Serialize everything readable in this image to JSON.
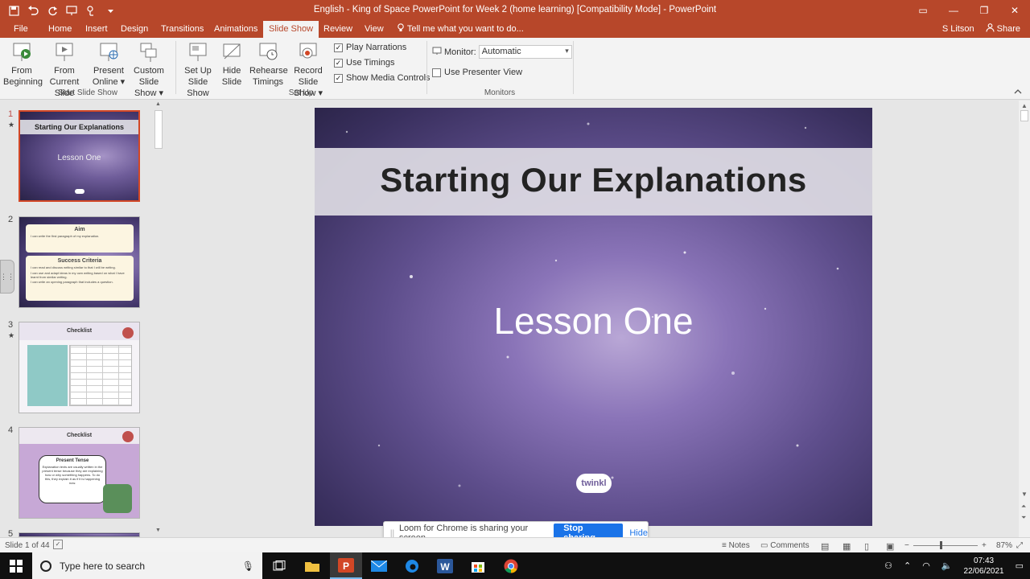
{
  "window": {
    "title": "English - King of Space PowerPoint for Week 2 (home learning) [Compatibility Mode] - PowerPoint",
    "controls": {
      "ribbon_display": "▭",
      "minimize": "—",
      "restore": "❐",
      "close": "✕"
    }
  },
  "qat": [
    "save-icon",
    "undo-icon",
    "redo-icon",
    "present-icon",
    "touch-mode-icon",
    "customize-icon"
  ],
  "tabs": [
    {
      "id": "file",
      "label": "File"
    },
    {
      "id": "home",
      "label": "Home"
    },
    {
      "id": "insert",
      "label": "Insert"
    },
    {
      "id": "design",
      "label": "Design"
    },
    {
      "id": "transitions",
      "label": "Transitions"
    },
    {
      "id": "animations",
      "label": "Animations"
    },
    {
      "id": "slideshow",
      "label": "Slide Show"
    },
    {
      "id": "review",
      "label": "Review"
    },
    {
      "id": "view",
      "label": "View"
    }
  ],
  "tellme": "Tell me what you want to do...",
  "user": {
    "name": "S Litson",
    "share": "Share"
  },
  "ribbon": {
    "start_group": {
      "label": "Start Slide Show",
      "buttons": [
        {
          "line1": "From",
          "line2": "Beginning"
        },
        {
          "line1": "From",
          "line2": "Current Slide"
        },
        {
          "line1": "Present",
          "line2": "Online ▾"
        },
        {
          "line1": "Custom Slide",
          "line2": "Show ▾"
        }
      ]
    },
    "setup_group": {
      "label": "Set Up",
      "buttons": [
        {
          "line1": "Set Up",
          "line2": "Slide Show"
        },
        {
          "line1": "Hide",
          "line2": "Slide"
        },
        {
          "line1": "Rehearse",
          "line2": "Timings"
        },
        {
          "line1": "Record Slide",
          "line2": "Show ▾"
        }
      ],
      "checks": [
        {
          "label": "Play Narrations",
          "checked": true
        },
        {
          "label": "Use Timings",
          "checked": true
        },
        {
          "label": "Show Media Controls",
          "checked": true
        }
      ]
    },
    "monitors_group": {
      "label": "Monitors",
      "monitor_label": "Monitor:",
      "monitor_value": "Automatic",
      "presenter_view": {
        "label": "Use Presenter View",
        "checked": false
      }
    }
  },
  "thumbnails": [
    {
      "num": "1",
      "title": "Starting Our Explanations",
      "subtitle": "Lesson One"
    },
    {
      "num": "2",
      "title": "Aim",
      "aim_text": "I can write the first paragraph of my explanation.",
      "title2": "Success Criteria",
      "bullets": [
        "I can read and discuss writing similar to that I will be writing.",
        "I can use and adapt ideas in my own writing based on what I have learnt from similar writing.",
        "I can write an opening paragraph that includes a question."
      ]
    },
    {
      "num": "3",
      "title": "Checklist"
    },
    {
      "num": "4",
      "title": "Checklist",
      "subtitle": "Present Tense",
      "body": "Explanation texts are usually written in the present tense because they are explaining how or why something happens. To do this, they explain it as if it is happening now."
    },
    {
      "num": "5"
    }
  ],
  "slide": {
    "title": "Starting Our Explanations",
    "subtitle": "Lesson One",
    "logo": "twinkl"
  },
  "loom": {
    "message": "Loom for Chrome is sharing your screen.",
    "stop": "Stop sharing",
    "hide": "Hide"
  },
  "status": {
    "slide_info": "Slide 1 of 44",
    "notes": "Notes",
    "comments": "Comments",
    "zoom": "87%",
    "zoom_percent": 87
  },
  "taskbar": {
    "search_placeholder": "Type here to search",
    "time": "07:43",
    "date": "22/06/2021"
  },
  "colors": {
    "accent": "#b7472a",
    "selection": "#d24726",
    "loom_button": "#1a73e8"
  }
}
